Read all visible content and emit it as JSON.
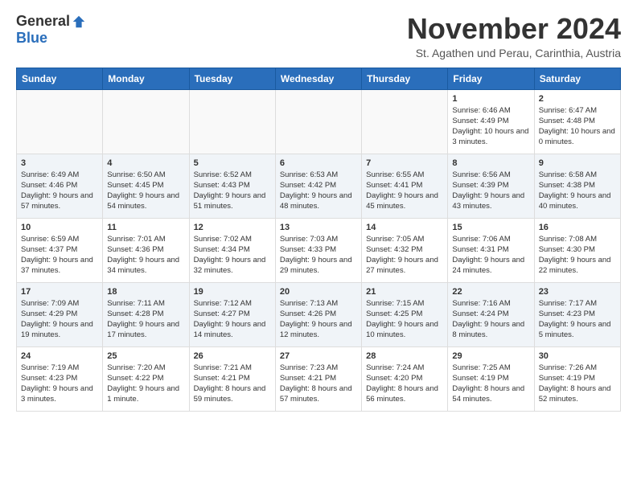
{
  "header": {
    "logo": {
      "general": "General",
      "blue": "Blue"
    },
    "title": "November 2024",
    "subtitle": "St. Agathen und Perau, Carinthia, Austria"
  },
  "calendar": {
    "weekdays": [
      "Sunday",
      "Monday",
      "Tuesday",
      "Wednesday",
      "Thursday",
      "Friday",
      "Saturday"
    ],
    "weeks": [
      [
        {
          "day": "",
          "sunrise": "",
          "sunset": "",
          "daylight": ""
        },
        {
          "day": "",
          "sunrise": "",
          "sunset": "",
          "daylight": ""
        },
        {
          "day": "",
          "sunrise": "",
          "sunset": "",
          "daylight": ""
        },
        {
          "day": "",
          "sunrise": "",
          "sunset": "",
          "daylight": ""
        },
        {
          "day": "",
          "sunrise": "",
          "sunset": "",
          "daylight": ""
        },
        {
          "day": "1",
          "sunrise": "Sunrise: 6:46 AM",
          "sunset": "Sunset: 4:49 PM",
          "daylight": "Daylight: 10 hours and 3 minutes."
        },
        {
          "day": "2",
          "sunrise": "Sunrise: 6:47 AM",
          "sunset": "Sunset: 4:48 PM",
          "daylight": "Daylight: 10 hours and 0 minutes."
        }
      ],
      [
        {
          "day": "3",
          "sunrise": "Sunrise: 6:49 AM",
          "sunset": "Sunset: 4:46 PM",
          "daylight": "Daylight: 9 hours and 57 minutes."
        },
        {
          "day": "4",
          "sunrise": "Sunrise: 6:50 AM",
          "sunset": "Sunset: 4:45 PM",
          "daylight": "Daylight: 9 hours and 54 minutes."
        },
        {
          "day": "5",
          "sunrise": "Sunrise: 6:52 AM",
          "sunset": "Sunset: 4:43 PM",
          "daylight": "Daylight: 9 hours and 51 minutes."
        },
        {
          "day": "6",
          "sunrise": "Sunrise: 6:53 AM",
          "sunset": "Sunset: 4:42 PM",
          "daylight": "Daylight: 9 hours and 48 minutes."
        },
        {
          "day": "7",
          "sunrise": "Sunrise: 6:55 AM",
          "sunset": "Sunset: 4:41 PM",
          "daylight": "Daylight: 9 hours and 45 minutes."
        },
        {
          "day": "8",
          "sunrise": "Sunrise: 6:56 AM",
          "sunset": "Sunset: 4:39 PM",
          "daylight": "Daylight: 9 hours and 43 minutes."
        },
        {
          "day": "9",
          "sunrise": "Sunrise: 6:58 AM",
          "sunset": "Sunset: 4:38 PM",
          "daylight": "Daylight: 9 hours and 40 minutes."
        }
      ],
      [
        {
          "day": "10",
          "sunrise": "Sunrise: 6:59 AM",
          "sunset": "Sunset: 4:37 PM",
          "daylight": "Daylight: 9 hours and 37 minutes."
        },
        {
          "day": "11",
          "sunrise": "Sunrise: 7:01 AM",
          "sunset": "Sunset: 4:36 PM",
          "daylight": "Daylight: 9 hours and 34 minutes."
        },
        {
          "day": "12",
          "sunrise": "Sunrise: 7:02 AM",
          "sunset": "Sunset: 4:34 PM",
          "daylight": "Daylight: 9 hours and 32 minutes."
        },
        {
          "day": "13",
          "sunrise": "Sunrise: 7:03 AM",
          "sunset": "Sunset: 4:33 PM",
          "daylight": "Daylight: 9 hours and 29 minutes."
        },
        {
          "day": "14",
          "sunrise": "Sunrise: 7:05 AM",
          "sunset": "Sunset: 4:32 PM",
          "daylight": "Daylight: 9 hours and 27 minutes."
        },
        {
          "day": "15",
          "sunrise": "Sunrise: 7:06 AM",
          "sunset": "Sunset: 4:31 PM",
          "daylight": "Daylight: 9 hours and 24 minutes."
        },
        {
          "day": "16",
          "sunrise": "Sunrise: 7:08 AM",
          "sunset": "Sunset: 4:30 PM",
          "daylight": "Daylight: 9 hours and 22 minutes."
        }
      ],
      [
        {
          "day": "17",
          "sunrise": "Sunrise: 7:09 AM",
          "sunset": "Sunset: 4:29 PM",
          "daylight": "Daylight: 9 hours and 19 minutes."
        },
        {
          "day": "18",
          "sunrise": "Sunrise: 7:11 AM",
          "sunset": "Sunset: 4:28 PM",
          "daylight": "Daylight: 9 hours and 17 minutes."
        },
        {
          "day": "19",
          "sunrise": "Sunrise: 7:12 AM",
          "sunset": "Sunset: 4:27 PM",
          "daylight": "Daylight: 9 hours and 14 minutes."
        },
        {
          "day": "20",
          "sunrise": "Sunrise: 7:13 AM",
          "sunset": "Sunset: 4:26 PM",
          "daylight": "Daylight: 9 hours and 12 minutes."
        },
        {
          "day": "21",
          "sunrise": "Sunrise: 7:15 AM",
          "sunset": "Sunset: 4:25 PM",
          "daylight": "Daylight: 9 hours and 10 minutes."
        },
        {
          "day": "22",
          "sunrise": "Sunrise: 7:16 AM",
          "sunset": "Sunset: 4:24 PM",
          "daylight": "Daylight: 9 hours and 8 minutes."
        },
        {
          "day": "23",
          "sunrise": "Sunrise: 7:17 AM",
          "sunset": "Sunset: 4:23 PM",
          "daylight": "Daylight: 9 hours and 5 minutes."
        }
      ],
      [
        {
          "day": "24",
          "sunrise": "Sunrise: 7:19 AM",
          "sunset": "Sunset: 4:23 PM",
          "daylight": "Daylight: 9 hours and 3 minutes."
        },
        {
          "day": "25",
          "sunrise": "Sunrise: 7:20 AM",
          "sunset": "Sunset: 4:22 PM",
          "daylight": "Daylight: 9 hours and 1 minute."
        },
        {
          "day": "26",
          "sunrise": "Sunrise: 7:21 AM",
          "sunset": "Sunset: 4:21 PM",
          "daylight": "Daylight: 8 hours and 59 minutes."
        },
        {
          "day": "27",
          "sunrise": "Sunrise: 7:23 AM",
          "sunset": "Sunset: 4:21 PM",
          "daylight": "Daylight: 8 hours and 57 minutes."
        },
        {
          "day": "28",
          "sunrise": "Sunrise: 7:24 AM",
          "sunset": "Sunset: 4:20 PM",
          "daylight": "Daylight: 8 hours and 56 minutes."
        },
        {
          "day": "29",
          "sunrise": "Sunrise: 7:25 AM",
          "sunset": "Sunset: 4:19 PM",
          "daylight": "Daylight: 8 hours and 54 minutes."
        },
        {
          "day": "30",
          "sunrise": "Sunrise: 7:26 AM",
          "sunset": "Sunset: 4:19 PM",
          "daylight": "Daylight: 8 hours and 52 minutes."
        }
      ]
    ]
  }
}
